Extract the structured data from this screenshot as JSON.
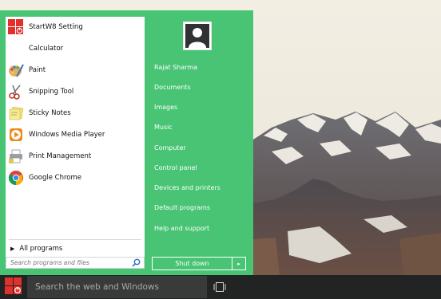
{
  "colors": {
    "menu_background": "#48c474",
    "taskbar": "#222423",
    "taskbar_search": "#393a3a",
    "start_logo": "#e0312d"
  },
  "apps": [
    {
      "label": "StartW8 Setting",
      "icon": "startw8-setting-icon"
    },
    {
      "label": "Calculator",
      "icon": "calculator-icon"
    },
    {
      "label": "Paint",
      "icon": "paint-icon"
    },
    {
      "label": "Snipping Tool",
      "icon": "snipping-tool-icon"
    },
    {
      "label": "Sticky Notes",
      "icon": "sticky-notes-icon"
    },
    {
      "label": "Windows Media Player",
      "icon": "media-player-icon"
    },
    {
      "label": "Print Management",
      "icon": "print-management-icon"
    },
    {
      "label": "Google Chrome",
      "icon": "chrome-icon"
    }
  ],
  "all_programs": "All programs",
  "search": {
    "placeholder": "Search programs and files"
  },
  "user_picture": "user-avatar-icon",
  "places": [
    "Rajat Sharma",
    "Documents",
    "Images",
    "Music",
    "Computer",
    "Control panel",
    "Devices and printers",
    "Default programs",
    "Help and support"
  ],
  "shutdown": {
    "label": "Shut down",
    "arrow": "▸"
  },
  "taskbar": {
    "search_placeholder": "Search the web and Windows",
    "start_icon": "startw8-logo-icon",
    "task_view_icon": "task-view-icon"
  }
}
